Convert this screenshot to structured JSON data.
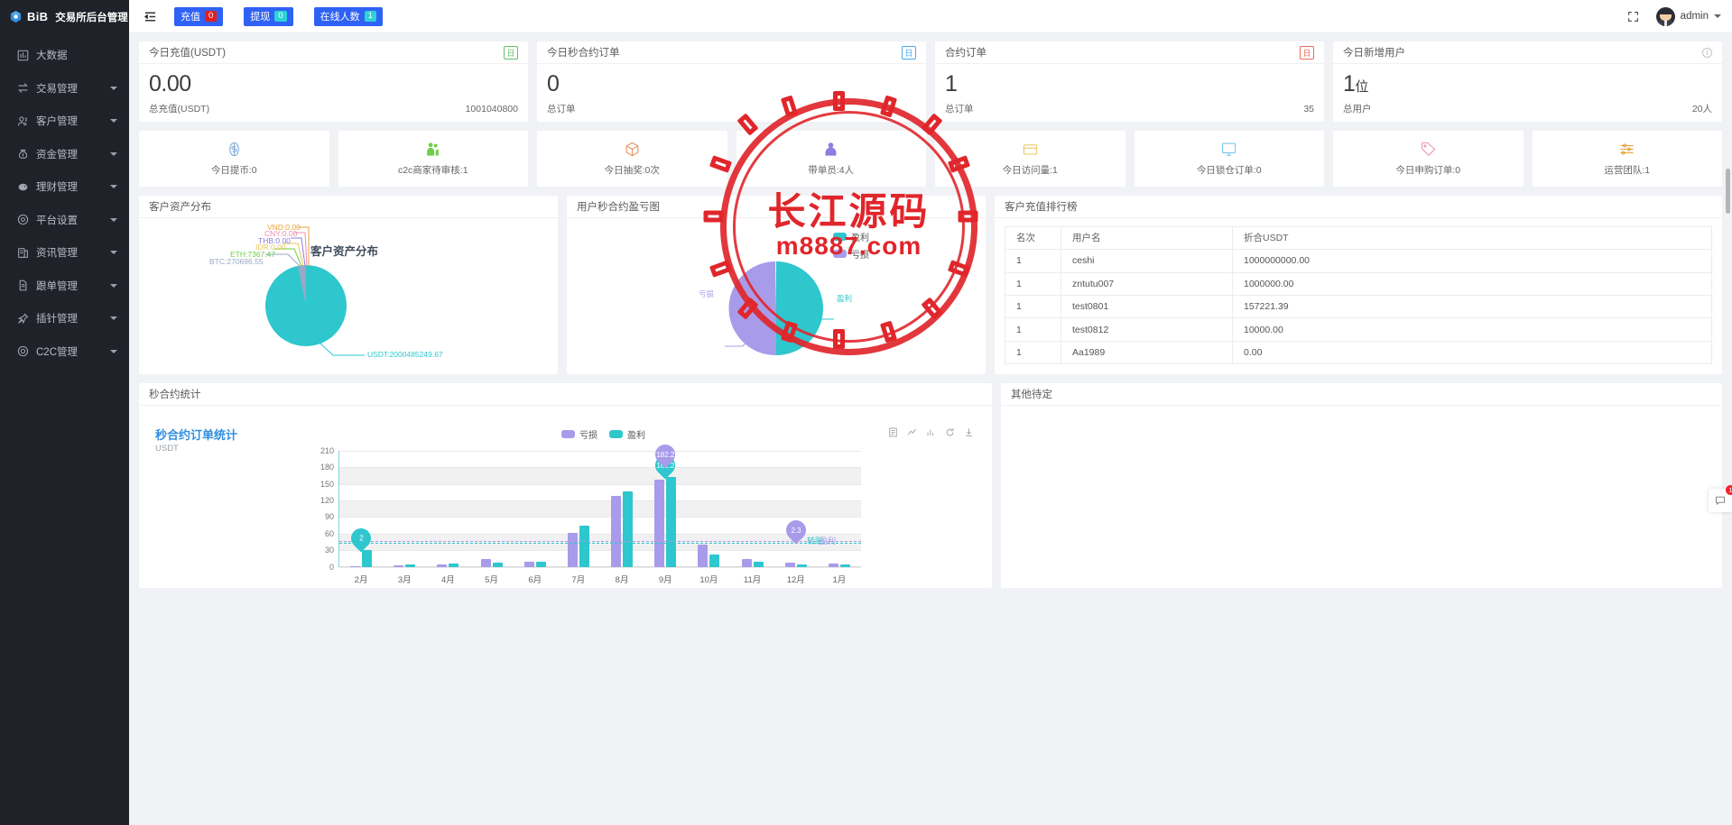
{
  "brand": {
    "logo_text": "BiB",
    "title": "交易所后台管理"
  },
  "sidebar": {
    "items": [
      {
        "label": "大数据",
        "icon": "chart-bar-icon",
        "caret": false
      },
      {
        "label": "交易管理",
        "icon": "exchange-icon",
        "caret": true
      },
      {
        "label": "客户管理",
        "icon": "users-icon",
        "caret": true
      },
      {
        "label": "资金管理",
        "icon": "money-bag-icon",
        "caret": true
      },
      {
        "label": "理财管理",
        "icon": "piggy-bank-icon",
        "caret": true
      },
      {
        "label": "平台设置",
        "icon": "gear-circle-icon",
        "caret": true
      },
      {
        "label": "资讯管理",
        "icon": "news-icon",
        "caret": true
      },
      {
        "label": "跟单管理",
        "icon": "document-icon",
        "caret": true
      },
      {
        "label": "插针管理",
        "icon": "pin-icon",
        "caret": true
      },
      {
        "label": "C2C管理",
        "icon": "c2c-icon",
        "caret": true
      }
    ]
  },
  "topbar": {
    "menu_icon": "hamburger-icon",
    "buttons": [
      {
        "label": "充值",
        "count": "0",
        "badge_color": "#e02020"
      },
      {
        "label": "提现",
        "count": "0",
        "badge_color": "#2bd3d8"
      },
      {
        "label": "在线人数",
        "count": "1",
        "badge_color": "#2bd3d8"
      }
    ],
    "fullscreen_icon": "fullscreen-icon",
    "user": {
      "name": "admin",
      "avatar": "avatar-icon",
      "caret": "chevron-down-icon"
    }
  },
  "kpis": [
    {
      "title": "今日充值(USDT)",
      "badge": "日",
      "badge_color": "#61c168",
      "value": "0.00",
      "suffix": "",
      "foot_label": "总充值(USDT)",
      "foot_value": "1001040800"
    },
    {
      "title": "今日秒合约订单",
      "badge": "日",
      "badge_color": "#4aa9e8",
      "value": "0",
      "suffix": "",
      "foot_label": "总订单",
      "foot_value": ""
    },
    {
      "title": "合约订单",
      "badge": "日",
      "badge_color": "#e86a5c",
      "value": "1",
      "suffix": "",
      "foot_label": "总订单",
      "foot_value": "35"
    },
    {
      "title": "今日新增用户",
      "badge": "",
      "badge_color": "",
      "value": "1",
      "suffix": "位",
      "foot_label": "总用户",
      "foot_value": "20人"
    }
  ],
  "tiles": [
    {
      "label": "今日提币:0",
      "icon": "dollar-circle-icon",
      "color": "#7ea6d8"
    },
    {
      "label": "c2c商家待审核:1",
      "icon": "two-users-icon",
      "color": "#6fcf48"
    },
    {
      "label": "今日抽奖:0次",
      "icon": "gift-box-icon",
      "color": "#e2915c"
    },
    {
      "label": "带单员:4人",
      "icon": "person-icon",
      "color": "#8e7ce0"
    },
    {
      "label": "今日访问量:1",
      "icon": "wallet-icon",
      "color": "#e8c65c"
    },
    {
      "label": "今日锁仓订单:0",
      "icon": "monitor-icon",
      "color": "#6fc4e8"
    },
    {
      "label": "今日申购订单:0",
      "icon": "tag-icon",
      "color": "#ef8bb4"
    },
    {
      "label": "运营团队:1",
      "icon": "sliders-icon",
      "color": "#e8a23c"
    }
  ],
  "assets_panel": {
    "header": "客户资产分布",
    "chart_title": "客户资产分布",
    "labels": [
      {
        "text": "VND:0.00",
        "color": "#e8a23c"
      },
      {
        "text": "CNY:0.00",
        "color": "#ef8bb4"
      },
      {
        "text": "THB:0.00",
        "color": "#8e7ce0"
      },
      {
        "text": "IDR:0.00",
        "color": "#e8c65c"
      },
      {
        "text": "ETH:7367.47",
        "color": "#6fcf48"
      },
      {
        "text": "BTC:270696.55",
        "color": "#9aa7c7"
      },
      {
        "text": "USDT:2000485249.67",
        "color": "#2ec7cd"
      }
    ]
  },
  "profit_panel": {
    "header": "用户秒合约盈亏图",
    "legend": [
      {
        "label": "盈利",
        "color": "#2ec7cd"
      },
      {
        "label": "亏损",
        "color": "#a89bea"
      }
    ],
    "slice_labels": [
      {
        "text": "亏损",
        "color": "#a89bea"
      },
      {
        "text": "盈利",
        "color": "#2ec7cd"
      }
    ]
  },
  "rank_panel": {
    "header": "客户充值排行榜",
    "columns": [
      "名次",
      "用户名",
      "折合USDT"
    ],
    "rows": [
      [
        "1",
        "ceshi",
        "1000000000.00"
      ],
      [
        "1",
        "zntutu007",
        "1000000.00"
      ],
      [
        "1",
        "test0801",
        "157221.39"
      ],
      [
        "1",
        "test0812",
        "10000.00"
      ],
      [
        "1",
        "Aa1989",
        "0.00"
      ]
    ]
  },
  "other_panel": {
    "header": "其他待定"
  },
  "chart_panel": {
    "header": "秒合约统计",
    "tools": [
      "data-view-icon",
      "line-switch-icon",
      "bar-switch-icon",
      "refresh-icon",
      "download-icon"
    ]
  },
  "chart_data": {
    "type": "bar",
    "title": "秒合约订单统计",
    "ylabel": "USDT",
    "xlabel": "",
    "categories": [
      "2月",
      "3月",
      "4月",
      "5月",
      "6月",
      "7月",
      "8月",
      "9月",
      "10月",
      "11月",
      "12月",
      "1月"
    ],
    "series": [
      {
        "name": "亏损",
        "color": "#a89bea",
        "values": [
          2,
          3,
          4,
          14,
          10,
          62,
          128,
          158,
          40,
          14,
          7,
          6
        ]
      },
      {
        "name": "盈利",
        "color": "#2ec7cd",
        "values": [
          30,
          4,
          6,
          7,
          9,
          75,
          137,
          162.2,
          23,
          9,
          5,
          4
        ]
      }
    ],
    "ylim": [
      0,
      210
    ],
    "yticks": [
      0,
      30,
      60,
      90,
      120,
      150,
      180,
      210
    ],
    "grid": true,
    "legend_position": "top-center",
    "annotations": [
      {
        "text": "2",
        "x_index": 0,
        "value": 30,
        "color": "#2ec7cd"
      },
      {
        "text": "162.2",
        "x_index": 7,
        "value": 162.2,
        "color": "#2ec7cd"
      },
      {
        "text": "182.2",
        "x_index": 7,
        "value": 182.2,
        "color": "#a89bea"
      },
      {
        "text": "2.3",
        "x_index": 10,
        "value": 45,
        "color": "#a89bea"
      }
    ],
    "extra_labels": [
      {
        "text": "转账",
        "color": "#2ec7cd"
      },
      {
        "text": "盈利",
        "color": "#a89bea"
      }
    ]
  },
  "watermark": {
    "line1": "长江源码",
    "line2": "m8887.com",
    "color": "#e0262b"
  },
  "float_button": {
    "icon": "message-icon",
    "count": "1"
  }
}
